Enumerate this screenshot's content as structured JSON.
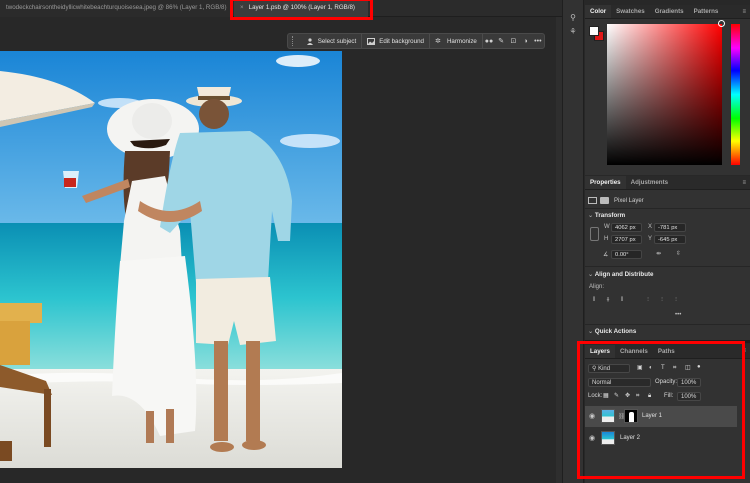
{
  "tabs": {
    "inactive": "twodeckchairsontheidyllicwhitebeachturquoisesea.jpeg @ 86% (Layer 1, RGB/8)",
    "active": "Layer 1.psb @ 100% (Layer 1, RGB/8)",
    "close_glyph": "×"
  },
  "taskbar": {
    "select_subject": "Select subject",
    "edit_background": "Edit background",
    "harmonize": "Harmonize",
    "more": "•••"
  },
  "color_panel": {
    "tabs": [
      "Color",
      "Swatches",
      "Gradients",
      "Patterns"
    ],
    "foreground": "#ffffff",
    "background": "#e01818"
  },
  "properties_panel": {
    "tabs": [
      "Properties",
      "Adjustments"
    ],
    "kind_label": "Pixel Layer",
    "transform_title": "Transform",
    "w_label": "W",
    "w_value": "4062 px",
    "x_label": "X",
    "x_value": "-781 px",
    "h_label": "H",
    "h_value": "2707 px",
    "y_label": "Y",
    "y_value": "-645 px",
    "angle_value": "0.00°",
    "align_title": "Align and Distribute",
    "align_label": "Align:",
    "more": "•••",
    "quick_actions": "Quick Actions"
  },
  "layers_panel": {
    "tabs": [
      "Layers",
      "Channels",
      "Paths"
    ],
    "filter_kind": "Kind",
    "blend_mode": "Normal",
    "opacity_label": "Opacity:",
    "opacity_value": "100%",
    "lock_label": "Lock:",
    "fill_label": "Fill:",
    "fill_value": "100%",
    "layers": [
      {
        "name": "Layer 1",
        "selected": true
      },
      {
        "name": "Layer 2",
        "selected": false
      }
    ]
  },
  "colors": {
    "highlight": "#ff0000",
    "panel": "#323232",
    "canvas_bg": "#282828"
  }
}
